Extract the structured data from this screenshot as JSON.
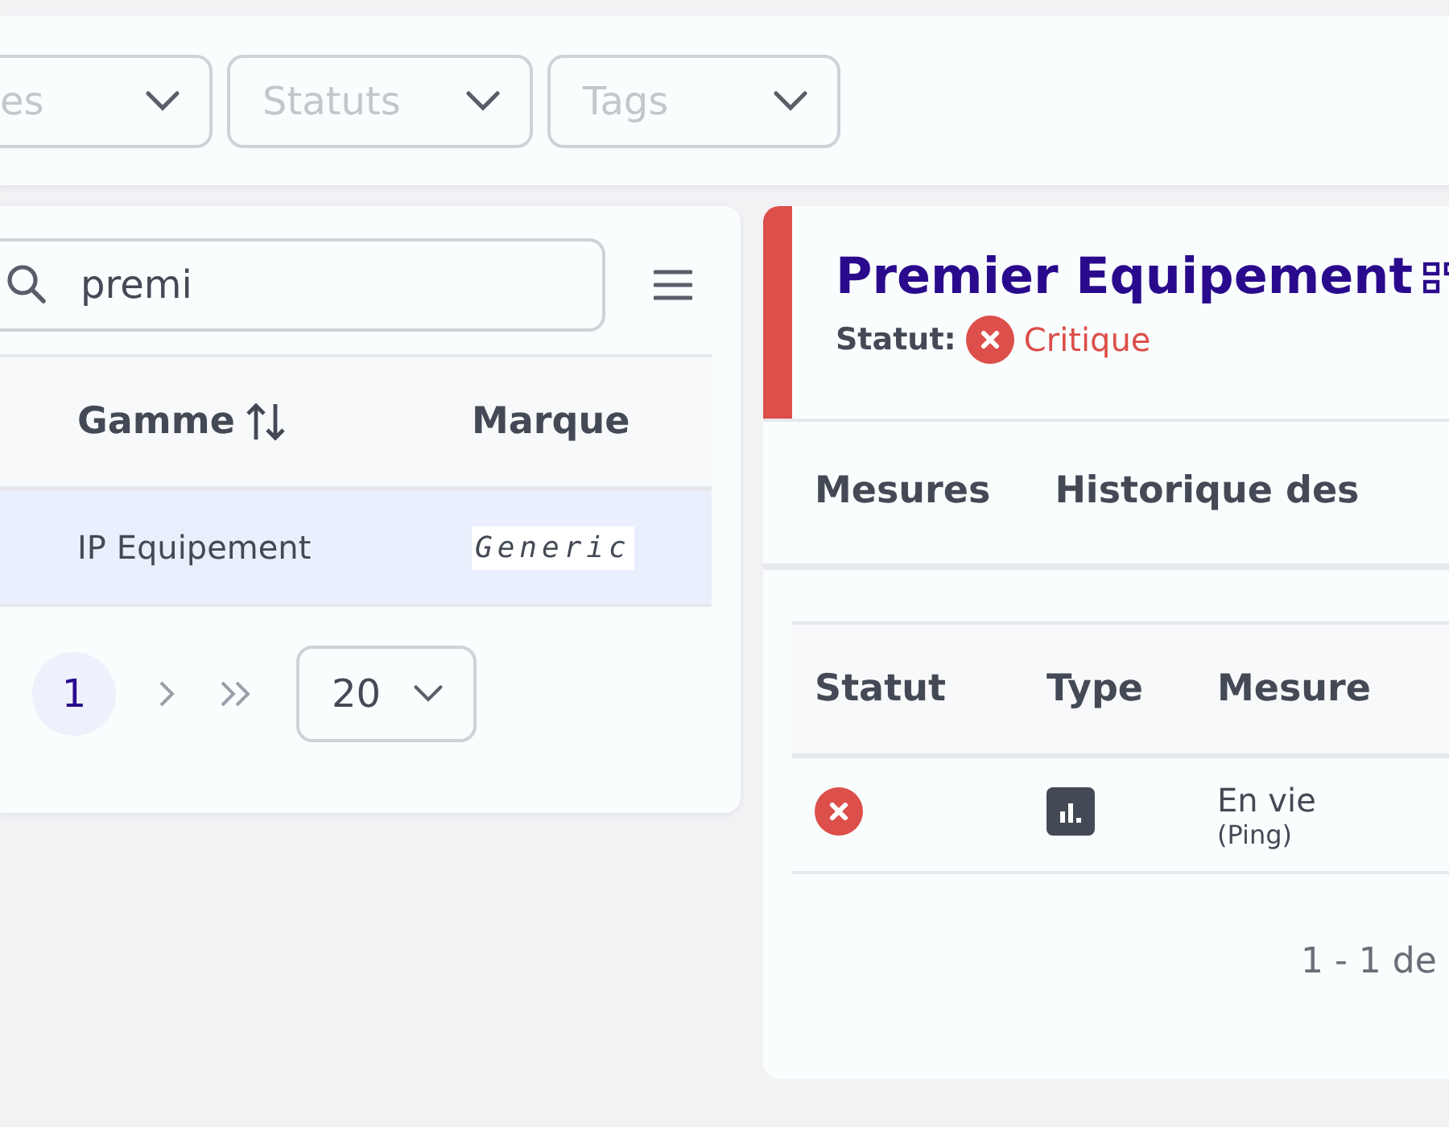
{
  "filters": [
    {
      "placeholder": "es"
    },
    {
      "placeholder": "Statuts"
    },
    {
      "placeholder": "Tags"
    }
  ],
  "list_panel": {
    "search": {
      "value": "premi"
    },
    "columns": [
      {
        "label": "Gamme",
        "sortable": true
      },
      {
        "label": "Marque",
        "sortable": false
      }
    ],
    "rows": [
      {
        "cells": [
          "IP Equipement",
          "Generic"
        ],
        "selected": true
      }
    ],
    "pages": [
      {
        "label": "1",
        "selected": true
      }
    ],
    "page_size": "20"
  },
  "detail": {
    "title": "Premier Equipement",
    "status_label": "Statut:",
    "status": {
      "kind": "critical",
      "label": "Critique"
    },
    "tabs": [
      {
        "label": "Mesures",
        "selected": false
      },
      {
        "label": "Historique des",
        "selected": false
      }
    ],
    "columns": [
      "Statut",
      "Type",
      "Mesure"
    ],
    "rows": [
      {
        "status": {
          "kind": "critical"
        },
        "type": {
          "kind": "chart"
        },
        "name": "En vie",
        "detail": "(Ping)"
      }
    ],
    "footer": "1 - 1 de"
  }
}
